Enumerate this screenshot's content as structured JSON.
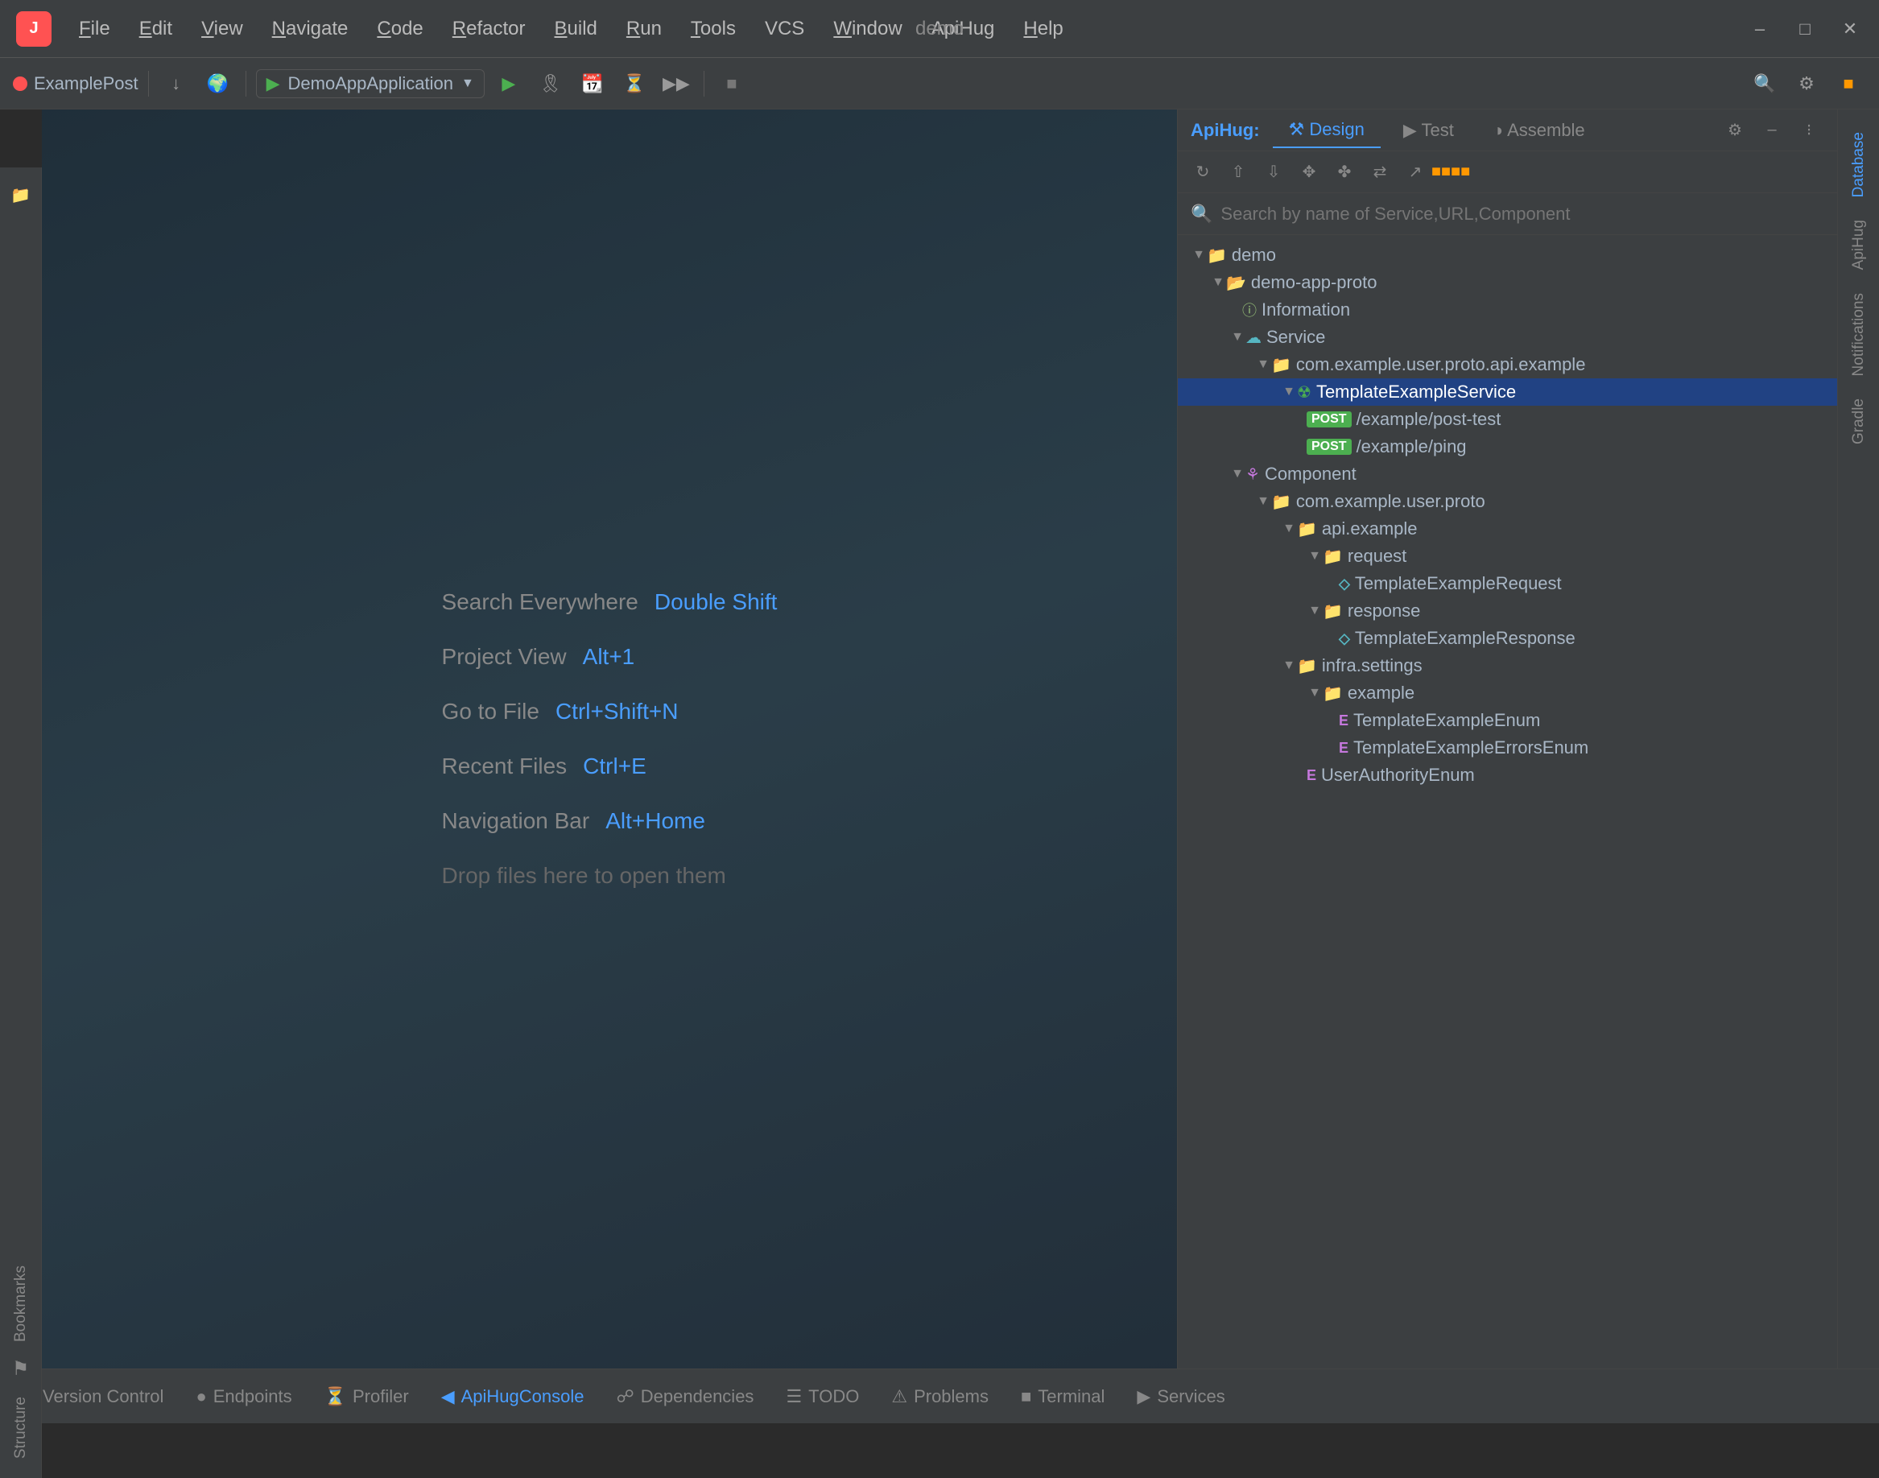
{
  "title_bar": {
    "app_icon": "J",
    "menu_items": [
      "File",
      "Edit",
      "View",
      "Navigate",
      "Code",
      "Refactor",
      "Build",
      "Run",
      "Tools",
      "VCS",
      "Window",
      "ApiHug",
      "Help"
    ],
    "window_title": "demo",
    "controls": [
      "minimize",
      "maximize",
      "close"
    ]
  },
  "toolbar": {
    "project_name": "ExamplePost",
    "run_config": "DemoAppApplication",
    "buttons": [
      "run",
      "debug",
      "coverage",
      "profile",
      "run-anything",
      "stop",
      "search",
      "settings",
      "colorful"
    ]
  },
  "editor": {
    "hints": [
      {
        "label": "Search Everywhere",
        "shortcut": "Double Shift"
      },
      {
        "label": "Project View",
        "shortcut": "Alt+1"
      },
      {
        "label": "Go to File",
        "shortcut": "Ctrl+Shift+N"
      },
      {
        "label": "Recent Files",
        "shortcut": "Ctrl+E"
      },
      {
        "label": "Navigation Bar",
        "shortcut": "Alt+Home"
      }
    ],
    "drop_hint": "Drop files here to open them"
  },
  "right_panel": {
    "label": "ApiHug",
    "tabs": [
      {
        "id": "design",
        "label": "Design",
        "icon": "design"
      },
      {
        "id": "test",
        "label": "Test",
        "icon": "test"
      },
      {
        "id": "assemble",
        "label": "Assemble",
        "icon": "assemble"
      }
    ],
    "toolbar_buttons": [
      "refresh",
      "align-top",
      "align-bottom",
      "expand",
      "collapse",
      "sync",
      "export",
      "colorful"
    ],
    "search_placeholder": "Search by name of Service,URL,Component",
    "tree": {
      "nodes": [
        {
          "id": "demo",
          "label": "demo",
          "level": 0,
          "type": "folder",
          "expanded": true
        },
        {
          "id": "demo-app-proto",
          "label": "demo-app-proto",
          "level": 1,
          "type": "folder",
          "expanded": true
        },
        {
          "id": "information",
          "label": "Information",
          "level": 2,
          "type": "info"
        },
        {
          "id": "service",
          "label": "Service",
          "level": 2,
          "type": "folder-service",
          "expanded": true
        },
        {
          "id": "com-example",
          "label": "com.example.user.proto.api.example",
          "level": 3,
          "type": "package",
          "expanded": true
        },
        {
          "id": "template-example-service",
          "label": "TemplateExampleService",
          "level": 4,
          "type": "service",
          "selected": true,
          "expanded": true
        },
        {
          "id": "post-test",
          "label": "/example/post-test",
          "level": 5,
          "type": "post"
        },
        {
          "id": "post-ping",
          "label": "/example/ping",
          "level": 5,
          "type": "post"
        },
        {
          "id": "component",
          "label": "Component",
          "level": 2,
          "type": "folder-component",
          "expanded": true
        },
        {
          "id": "com-example-user",
          "label": "com.example.user.proto",
          "level": 3,
          "type": "package",
          "expanded": true
        },
        {
          "id": "api-example",
          "label": "api.example",
          "level": 4,
          "type": "package",
          "expanded": true
        },
        {
          "id": "request-folder",
          "label": "request",
          "level": 5,
          "type": "folder",
          "expanded": true
        },
        {
          "id": "template-request",
          "label": "TemplateExampleRequest",
          "level": 6,
          "type": "message"
        },
        {
          "id": "response-folder",
          "label": "response",
          "level": 5,
          "type": "folder",
          "expanded": true
        },
        {
          "id": "template-response",
          "label": "TemplateExampleResponse",
          "level": 6,
          "type": "message"
        },
        {
          "id": "infra-settings",
          "label": "infra.settings",
          "level": 4,
          "type": "package",
          "expanded": true
        },
        {
          "id": "example-folder",
          "label": "example",
          "level": 5,
          "type": "folder",
          "expanded": true
        },
        {
          "id": "template-enum",
          "label": "TemplateExampleEnum",
          "level": 6,
          "type": "enum"
        },
        {
          "id": "template-errors-enum",
          "label": "TemplateExampleErrorsEnum",
          "level": 6,
          "type": "enum"
        },
        {
          "id": "user-authority-enum",
          "label": "UserAuthorityEnum",
          "level": 5,
          "type": "enum"
        }
      ]
    }
  },
  "right_sidebar_tabs": [
    "Database",
    "ApiHug",
    "Notifications",
    "Gradle"
  ],
  "left_vert_tabs": {
    "top_icons": [
      "folder"
    ],
    "bottom_tabs": [
      "Structure",
      "Bookmarks"
    ]
  },
  "bottom_tabs": [
    {
      "id": "version-control",
      "label": "Version Control",
      "icon": "vc"
    },
    {
      "id": "endpoints",
      "label": "Endpoints",
      "icon": "ep"
    },
    {
      "id": "profiler",
      "label": "Profiler",
      "icon": "pr"
    },
    {
      "id": "apihug-console",
      "label": "ApiHugConsole",
      "icon": "ah",
      "active": true
    },
    {
      "id": "dependencies",
      "label": "Dependencies",
      "icon": "dep"
    },
    {
      "id": "todo",
      "label": "TODO",
      "icon": "todo"
    },
    {
      "id": "problems",
      "label": "Problems",
      "icon": "prob"
    },
    {
      "id": "terminal",
      "label": "Terminal",
      "icon": "term"
    },
    {
      "id": "services",
      "label": "Services",
      "icon": "svc"
    }
  ],
  "colors": {
    "accent_blue": "#4a9eff",
    "accent_green": "#4caf50",
    "accent_red": "#ff5252",
    "selected_bg": "#214283",
    "panel_bg": "#3c3f41",
    "editor_bg": "#2b2b2b"
  }
}
